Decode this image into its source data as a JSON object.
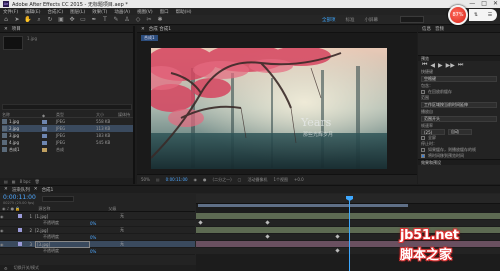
{
  "titlebar": {
    "app_icon": "Ae",
    "title": "Adobe After Effects CC 2015 - 无标题项目.aep *",
    "buttons": [
      "—",
      "□",
      "✕"
    ]
  },
  "menubar": {
    "items": [
      "文件(F)",
      "编辑(E)",
      "合成(C)",
      "图层(L)",
      "效果(T)",
      "动画(A)",
      "视图(V)",
      "窗口",
      "帮助(H)"
    ]
  },
  "toolbar": {
    "icons": [
      "home-icon",
      "arrow-icon",
      "hand-icon",
      "zoom-icon",
      "rotate-icon",
      "camera-icon",
      "pan-icon",
      "rect-icon",
      "pen-icon",
      "text-icon",
      "brush-icon",
      "stamp-icon",
      "eraser-icon",
      "roto-icon",
      "puppet-icon"
    ],
    "workspace_tabs": [
      "全部项",
      "标准",
      "小屏幕"
    ],
    "workspace_active": "全部项"
  },
  "cpu_widget": {
    "percent": "87%",
    "side_icons": [
      "⇅",
      "☰"
    ]
  },
  "project": {
    "tab_label": "项目",
    "thumb_text": "1.jpg",
    "columns": [
      "名称",
      "类型",
      "大小",
      "媒体持",
      "入点"
    ],
    "rows": [
      {
        "name": "1.jpg",
        "color": "#6e86b0",
        "type": "JPEG",
        "size": "558 KB",
        "selected": false
      },
      {
        "name": "2.jpg",
        "color": "#6e86b0",
        "type": "JPEG",
        "size": "113 KB",
        "selected": true
      },
      {
        "name": "3.jpg",
        "color": "#6e86b0",
        "type": "JPEG",
        "size": "183 KB",
        "selected": false
      },
      {
        "name": "4.jpg",
        "color": "#6e86b0",
        "type": "JPEG",
        "size": "545 KB",
        "selected": false
      },
      {
        "name": "合成1",
        "color": "#c0a060",
        "type": "合成",
        "size": "",
        "selected": false
      }
    ],
    "footer": [
      "8 bpc"
    ]
  },
  "viewer": {
    "tab_label": "合成 合成1",
    "comp_label": "合成1",
    "footer": {
      "zoom": "50%",
      "timecode": "0:00:11:00",
      "resolution": "(二分之一)",
      "camera": "活动摄像机",
      "views": "1个视图",
      "offset": "+0.0"
    }
  },
  "rightpanel": {
    "tabs": [
      "信息",
      "音频"
    ],
    "preview_hdr": "预览",
    "play_controls": [
      "⏮",
      "◀",
      "▶",
      "▶▶",
      "⏭"
    ],
    "shortcut_label": "快捷键",
    "shortcut_value": "空格键",
    "include_label": "包含：",
    "cache_label": "在回放前缓存",
    "range_label": "范围",
    "range_value": "工作区域按当前时间延伸",
    "play_from_label": "播放自",
    "play_from_value": "范围开头",
    "frame_rate_label": "帧速率",
    "frame_rate_value": "(25)",
    "resolution_value": "自动",
    "fullscreen_label": "全屏",
    "effects_hdr": "效果和预设",
    "stop_label": "停止时：",
    "if_cache_label": "如果缓存，则播放缓存的帧",
    "move_time_label": "将时间移到预览时间"
  },
  "timeline": {
    "tabs": [
      "渲染队列",
      "合成1"
    ],
    "timecode": "0:00:11:00",
    "fps": "00275 (25.00 fps)",
    "columns": [
      "源名称",
      "父级"
    ],
    "layers": [
      {
        "num": "1",
        "name": "[1.jpg]",
        "color": "#9a9ad8",
        "mode": "",
        "parent": "无",
        "sub": false,
        "selected": false,
        "boxed": false
      },
      {
        "num": "",
        "name": "不透明度",
        "color": "",
        "mode": "",
        "parent": "",
        "value": "0%",
        "sub": true,
        "selected": false,
        "boxed": false
      },
      {
        "num": "2",
        "name": "[2.jpg]",
        "color": "#9a9ad8",
        "mode": "",
        "parent": "无",
        "sub": false,
        "selected": false,
        "boxed": false
      },
      {
        "num": "",
        "name": "不透明度",
        "color": "",
        "mode": "",
        "parent": "",
        "value": "0%",
        "sub": true,
        "selected": false,
        "boxed": false
      },
      {
        "num": "3",
        "name": "[3.jpg]",
        "color": "#9a9ad8",
        "mode": "",
        "parent": "无",
        "sub": false,
        "selected": true,
        "boxed": true
      },
      {
        "num": "",
        "name": "不透明度",
        "color": "",
        "mode": "",
        "parent": "",
        "value": "0%",
        "sub": true,
        "selected": false,
        "boxed": false
      }
    ],
    "footer": [
      "切换开关/模式"
    ]
  },
  "watermark": {
    "url": "jb51.net",
    "cn": "脚本之家"
  },
  "colors": {
    "accent": "#3ea8ff",
    "panel": "#232323",
    "selection": "#3a4a5e"
  }
}
